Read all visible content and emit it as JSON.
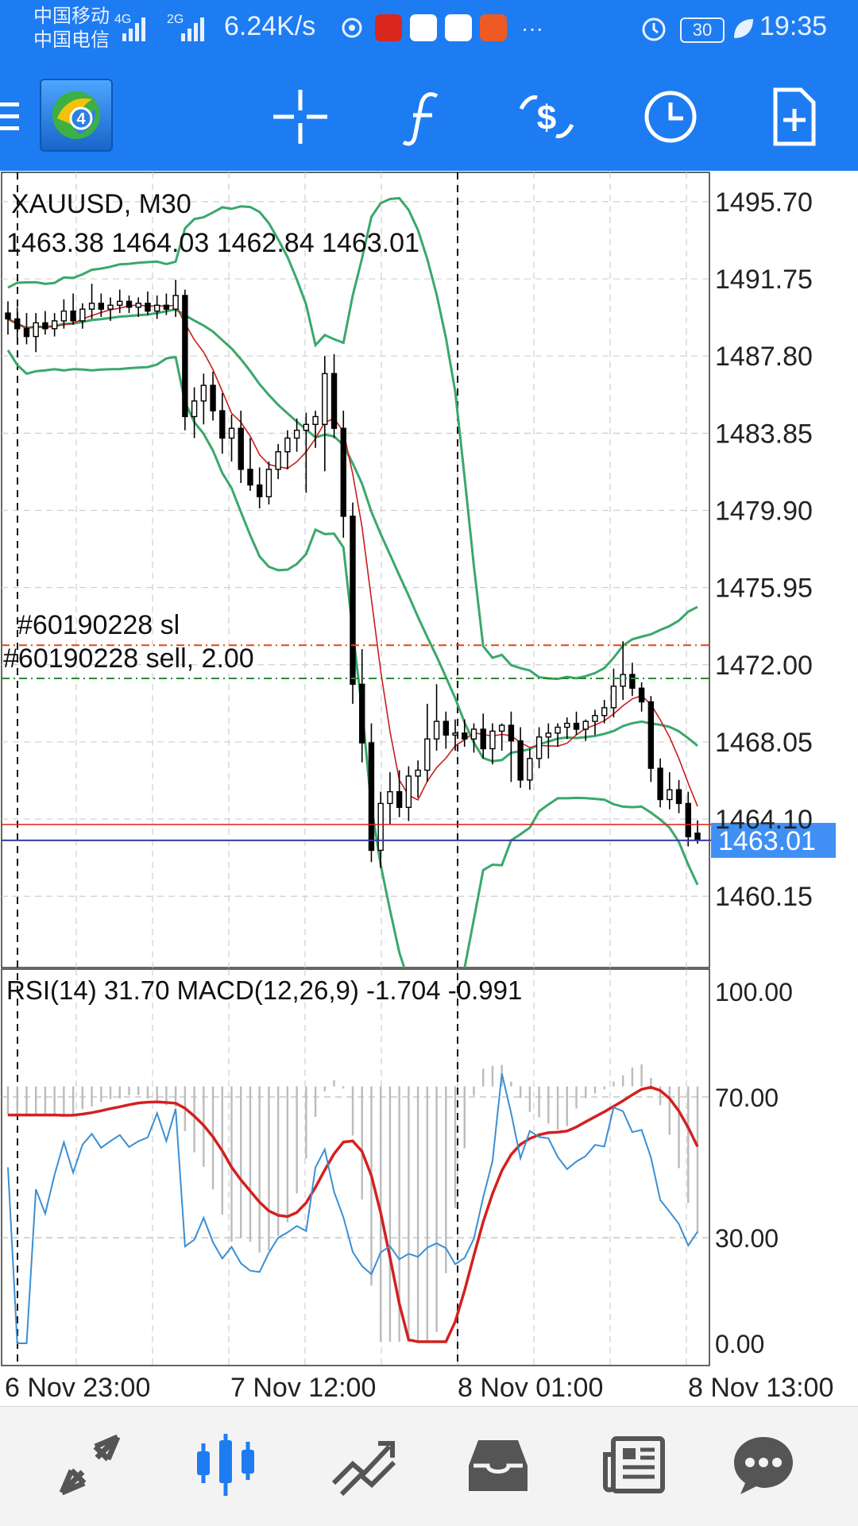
{
  "status_bar": {
    "carrier_1": "中国移动",
    "carrier_2": "中国电信",
    "network_1": "4G",
    "network_2": "2G",
    "speed": "6.24K/s",
    "more": "···",
    "battery": "30",
    "time": "19:35"
  },
  "toolbar": {
    "icons": [
      "menu-icon",
      "metatrader-logo",
      "crosshair-icon",
      "indicators-icon",
      "trade-icon",
      "timeframe-clock-icon",
      "new-order-icon"
    ]
  },
  "chart_data": {
    "type": "candlestick",
    "title": "XAUUSD, M30",
    "ohlc_label": "1463.38 1464.03 1462.84 1463.01",
    "price_axis": {
      "ticks": [
        "1495.70",
        "1491.75",
        "1487.80",
        "1483.85",
        "1479.90",
        "1475.95",
        "1472.00",
        "1468.05",
        "1464.10",
        "1460.15"
      ],
      "current_price": "1463.01"
    },
    "order_lines": [
      {
        "label": "#60190228 sl",
        "price": 1473.0,
        "color": "#e8431c"
      },
      {
        "label": "#60190228 sell, 2.00",
        "price": 1471.3,
        "color": "#2e8b2e"
      }
    ],
    "indicator": {
      "label": "RSI(14) 31.70 MACD(12,26,9) -1.704 -0.991",
      "ticks": [
        "100.00",
        "70.00",
        "30.00",
        "0.00"
      ],
      "rsi_value": 31.7,
      "macd_main": -1.704,
      "macd_signal": -0.991
    },
    "time_axis": [
      "6 Nov 23:00",
      "7 Nov 12:00",
      "8 Nov 01:00",
      "8 Nov 13:00"
    ],
    "period_separators": [
      "7 Nov",
      "8 Nov"
    ],
    "colors": {
      "bollinger": "#3aa86b",
      "ma": "#c81e1e",
      "rsi": "#3b8fd4",
      "macd_hist": "#bbbbbb",
      "signal": "#d42020",
      "current": "#3f8ff5"
    },
    "candles": [
      [
        1490.0,
        1490.6,
        1488.9,
        1489.7
      ],
      [
        1489.7,
        1490.3,
        1488.7,
        1489.2
      ],
      [
        1489.2,
        1490.0,
        1488.4,
        1488.8
      ],
      [
        1488.8,
        1490.0,
        1488.0,
        1489.5
      ],
      [
        1489.5,
        1490.1,
        1488.9,
        1489.2
      ],
      [
        1489.2,
        1490.0,
        1488.8,
        1489.6
      ],
      [
        1489.6,
        1490.7,
        1489.2,
        1490.1
      ],
      [
        1490.1,
        1491.0,
        1489.4,
        1489.6
      ],
      [
        1489.6,
        1490.5,
        1489.2,
        1490.2
      ],
      [
        1490.2,
        1491.5,
        1489.7,
        1490.5
      ],
      [
        1490.5,
        1491.0,
        1489.8,
        1490.2
      ],
      [
        1490.2,
        1490.8,
        1489.6,
        1490.4
      ],
      [
        1490.4,
        1491.2,
        1490.0,
        1490.6
      ],
      [
        1490.6,
        1490.9,
        1490.0,
        1490.3
      ],
      [
        1490.3,
        1490.8,
        1489.8,
        1490.5
      ],
      [
        1490.5,
        1491.1,
        1489.9,
        1490.1
      ],
      [
        1490.1,
        1490.9,
        1489.7,
        1490.4
      ],
      [
        1490.4,
        1491.0,
        1489.9,
        1490.2
      ],
      [
        1490.2,
        1491.7,
        1489.8,
        1490.9
      ],
      [
        1490.9,
        1491.2,
        1484.0,
        1484.7
      ],
      [
        1484.7,
        1486.2,
        1483.6,
        1485.5
      ],
      [
        1485.5,
        1486.9,
        1484.3,
        1486.3
      ],
      [
        1486.3,
        1487.0,
        1484.5,
        1485.0
      ],
      [
        1485.0,
        1485.9,
        1482.8,
        1483.6
      ],
      [
        1483.6,
        1484.8,
        1482.4,
        1484.1
      ],
      [
        1484.1,
        1485.0,
        1481.3,
        1482.0
      ],
      [
        1482.0,
        1483.6,
        1480.9,
        1481.2
      ],
      [
        1481.2,
        1482.1,
        1480.0,
        1480.6
      ],
      [
        1480.6,
        1482.4,
        1480.2,
        1482.0
      ],
      [
        1482.0,
        1483.3,
        1481.5,
        1482.9
      ],
      [
        1482.9,
        1484.0,
        1482.0,
        1483.6
      ],
      [
        1483.6,
        1484.6,
        1482.9,
        1484.0
      ],
      [
        1484.0,
        1484.9,
        1480.8,
        1484.3
      ],
      [
        1484.3,
        1485.0,
        1483.1,
        1484.7
      ],
      [
        1484.3,
        1487.8,
        1481.9,
        1486.9
      ],
      [
        1486.9,
        1487.9,
        1483.6,
        1484.1
      ],
      [
        1484.1,
        1485.0,
        1478.5,
        1479.6
      ],
      [
        1479.6,
        1480.3,
        1470.0,
        1471.0
      ],
      [
        1471.0,
        1472.8,
        1467.0,
        1468.0
      ],
      [
        1468.0,
        1469.0,
        1461.9,
        1462.5
      ],
      [
        1462.5,
        1465.5,
        1461.6,
        1464.9
      ],
      [
        1464.9,
        1466.5,
        1463.8,
        1465.5
      ],
      [
        1465.5,
        1466.6,
        1464.2,
        1464.7
      ],
      [
        1464.7,
        1466.8,
        1464.0,
        1466.3
      ],
      [
        1466.3,
        1467.1,
        1465.2,
        1466.6
      ],
      [
        1466.6,
        1470.0,
        1466.0,
        1468.2
      ],
      [
        1468.2,
        1471.0,
        1467.6,
        1469.1
      ],
      [
        1469.1,
        1469.6,
        1467.7,
        1468.4
      ],
      [
        1468.4,
        1469.2,
        1467.6,
        1468.5
      ],
      [
        1468.5,
        1469.2,
        1467.8,
        1468.2
      ],
      [
        1468.2,
        1469.0,
        1467.5,
        1468.7
      ],
      [
        1468.7,
        1469.5,
        1467.2,
        1467.7
      ],
      [
        1467.7,
        1469.0,
        1466.9,
        1468.6
      ],
      [
        1468.6,
        1469.0,
        1467.6,
        1468.9
      ],
      [
        1468.9,
        1469.6,
        1466.0,
        1468.1
      ],
      [
        1468.1,
        1468.8,
        1465.7,
        1466.1
      ],
      [
        1466.1,
        1467.7,
        1465.6,
        1467.2
      ],
      [
        1467.2,
        1468.8,
        1466.7,
        1468.3
      ],
      [
        1468.3,
        1469.0,
        1467.2,
        1468.5
      ],
      [
        1468.5,
        1469.0,
        1467.8,
        1468.8
      ],
      [
        1468.8,
        1469.3,
        1468.2,
        1469.0
      ],
      [
        1469.0,
        1469.6,
        1468.4,
        1468.7
      ],
      [
        1468.7,
        1469.2,
        1468.1,
        1469.1
      ],
      [
        1469.1,
        1469.7,
        1468.4,
        1469.4
      ],
      [
        1469.4,
        1470.2,
        1469.0,
        1469.8
      ],
      [
        1469.8,
        1471.8,
        1469.3,
        1470.9
      ],
      [
        1470.9,
        1473.2,
        1470.2,
        1471.5
      ],
      [
        1471.5,
        1472.1,
        1470.4,
        1470.8
      ],
      [
        1470.8,
        1471.1,
        1469.6,
        1470.1
      ],
      [
        1470.1,
        1470.4,
        1466.0,
        1466.7
      ],
      [
        1466.7,
        1467.2,
        1464.7,
        1465.1
      ],
      [
        1465.1,
        1466.5,
        1464.6,
        1465.6
      ],
      [
        1465.6,
        1466.1,
        1464.4,
        1464.9
      ],
      [
        1464.9,
        1465.5,
        1462.7,
        1463.2
      ],
      [
        1463.38,
        1464.03,
        1462.84,
        1463.01
      ]
    ]
  },
  "bottom_nav": {
    "icons": [
      "quotes-icon",
      "chart-icon",
      "trade-icon",
      "history-icon",
      "news-icon",
      "chat-icon"
    ],
    "active": "chart-icon"
  }
}
